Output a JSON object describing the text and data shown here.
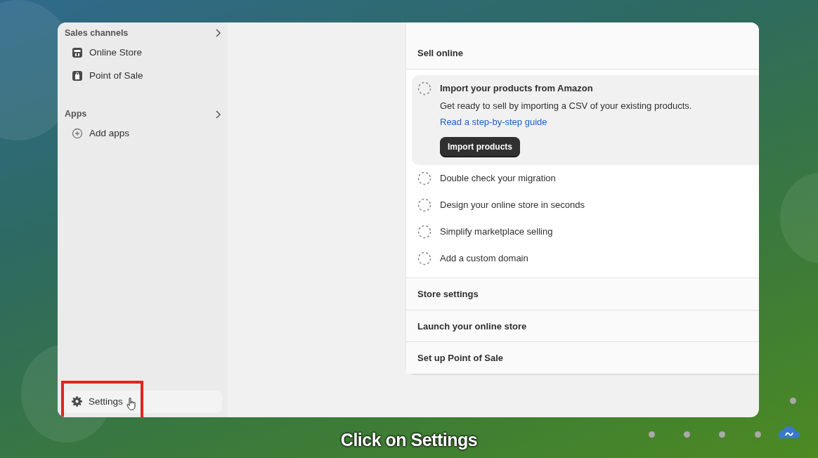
{
  "sidebar": {
    "sections": [
      {
        "title": "Sales channels",
        "items": [
          {
            "label": "Online Store",
            "kind": "store"
          },
          {
            "label": "Point of Sale",
            "kind": "pos"
          }
        ]
      },
      {
        "title": "Apps",
        "items": [
          {
            "label": "Add apps",
            "kind": "add"
          }
        ]
      }
    ],
    "settings": {
      "label": "Settings",
      "highlighted": true
    }
  },
  "setup": {
    "sections": [
      {
        "title": "Sell online",
        "expanded": true,
        "tasks": [
          {
            "title": "Import your products from Amazon",
            "expanded": true,
            "done": false,
            "description": "Get ready to sell by importing a CSV of your existing products.",
            "link": "Read a step-by-step guide",
            "button": "Import products"
          },
          {
            "title": "Double check your migration",
            "expanded": false,
            "done": false
          },
          {
            "title": "Design your online store in seconds",
            "expanded": false,
            "done": false
          },
          {
            "title": "Simplify marketplace selling",
            "expanded": false,
            "done": false
          },
          {
            "title": "Add a custom domain",
            "expanded": false,
            "done": false
          }
        ]
      },
      {
        "title": "Store settings",
        "expanded": false
      },
      {
        "title": "Launch your online store",
        "expanded": false
      },
      {
        "title": "Set up Point of Sale",
        "expanded": false
      }
    ]
  },
  "caption": "Click on Settings"
}
